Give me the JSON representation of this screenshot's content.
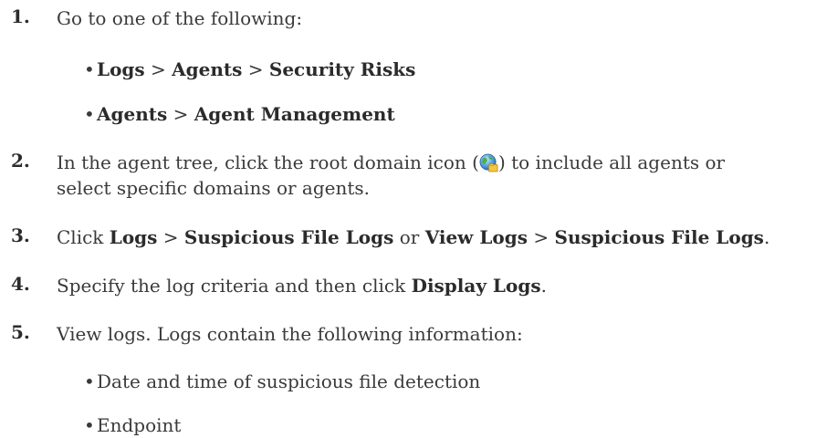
{
  "steps": [
    {
      "num": "1.",
      "text": "Go to one of the following:"
    },
    {
      "num": "2.",
      "text_a": "In the agent tree, click the root domain icon (",
      "text_b": ") to include all agents or",
      "text_c": "select specific domains or agents."
    },
    {
      "num": "3.",
      "t1": "Click ",
      "b1": "Logs",
      "t2": " > ",
      "b2": "Suspicious File Logs",
      "t3": " or ",
      "b3": "View Logs",
      "t4": " > ",
      "b4": "Suspicious File Logs",
      "t5": "."
    },
    {
      "num": "4.",
      "t1": "Specify the log criteria and then click ",
      "b1": "Display Logs",
      "t2": "."
    },
    {
      "num": "5.",
      "text": "View logs. Logs contain the following information:"
    }
  ],
  "bullets_step1": [
    {
      "b1": "Logs",
      "sep1": " > ",
      "b2": "Agents",
      "sep2": " > ",
      "b3": "Security Risks"
    },
    {
      "b1": "Agents",
      "sep1": " > ",
      "b2": "Agent Management"
    }
  ],
  "bullets_step5": [
    "Date and time of suspicious file detection",
    "Endpoint"
  ],
  "bullet_char": "•",
  "icon": {
    "name": "root-domain-globe-icon"
  }
}
